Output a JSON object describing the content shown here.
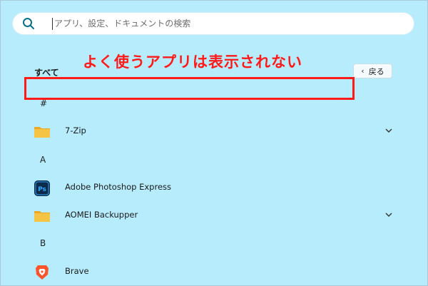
{
  "search": {
    "placeholder": "アプリ、設定、ドキュメントの検索",
    "value": ""
  },
  "header": {
    "all_label": "すべて",
    "back_label": "戻る"
  },
  "annotation": {
    "text": "よく使うアプリは表示されない",
    "color": "#ff1a1a"
  },
  "sections": {
    "hash": "#",
    "a": "A",
    "b": "B"
  },
  "apps": [
    {
      "name": "7-Zip",
      "icon": "folder-icon",
      "expandable": true
    },
    {
      "name": "Adobe Photoshop Express",
      "icon": "photoshop-express-icon",
      "expandable": false
    },
    {
      "name": "AOMEI Backupper",
      "icon": "folder-icon",
      "expandable": true
    },
    {
      "name": "Brave",
      "icon": "brave-icon",
      "expandable": false
    }
  ],
  "colors": {
    "background": "#b6ecfb",
    "folder": "#f6c445",
    "photoshop": "#0b2a4a",
    "brave": "#fb542b"
  }
}
